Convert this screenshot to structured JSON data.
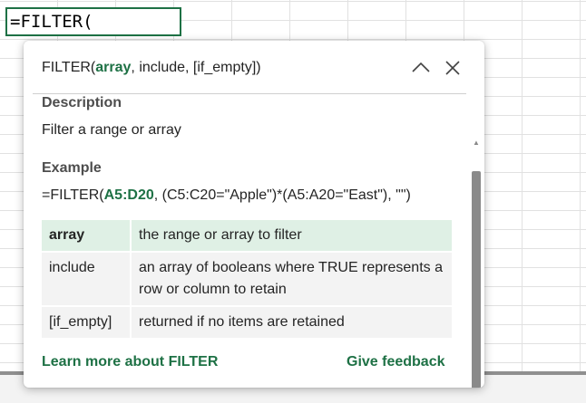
{
  "cell": {
    "formula": "=FILTER("
  },
  "tooltip": {
    "signature": {
      "function": "FILTER(",
      "active_arg": "array",
      "rest": ", include, [if_empty])"
    },
    "icons": {
      "collapse": "chevron-up-icon",
      "close": "close-icon"
    },
    "description_heading": "Description",
    "description_text": "Filter a range or array",
    "example_heading": "Example",
    "example": {
      "prefix": "=FILTER(",
      "highlight": "A5:D20",
      "suffix": ", (C5:C20=\"Apple\")*(A5:A20=\"East\"), \"\")"
    },
    "arguments": [
      {
        "name": "array",
        "desc": "the range or array to filter",
        "active": true
      },
      {
        "name": "include",
        "desc": "an array of booleans where TRUE represents a row or column to retain",
        "active": false
      },
      {
        "name": "[if_empty]",
        "desc": "returned if no items are retained",
        "active": false
      }
    ],
    "learn_more_label": "Learn more about FILTER",
    "feedback_label": "Give feedback"
  },
  "colors": {
    "accent": "#1e7145",
    "active_row": "#dff0e5",
    "row_bg": "#f3f3f3"
  }
}
